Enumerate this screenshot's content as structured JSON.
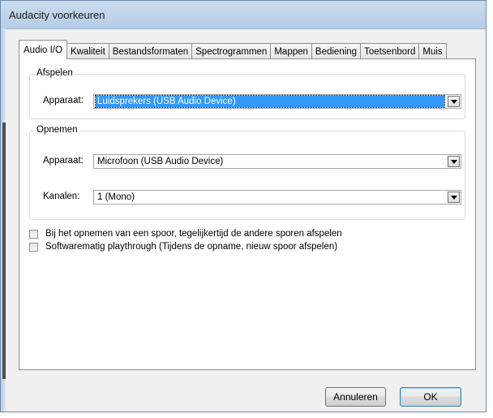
{
  "window": {
    "title": "Audacity voorkeuren"
  },
  "tabs": [
    {
      "label": "Audio I/O",
      "active": true
    },
    {
      "label": "Kwaliteit"
    },
    {
      "label": "Bestandsformaten"
    },
    {
      "label": "Spectrogrammen"
    },
    {
      "label": "Mappen"
    },
    {
      "label": "Bediening"
    },
    {
      "label": "Toetsenbord"
    },
    {
      "label": "Muis"
    }
  ],
  "playback": {
    "legend": "Afspelen",
    "device_label": "Apparaat:",
    "device_value": "Luidsprekers (USB Audio Device)"
  },
  "recording": {
    "legend": "Opnemen",
    "device_label": "Apparaat:",
    "device_value": "Microfoon (USB Audio Device)",
    "channels_label": "Kanalen:",
    "channels_value": "1 (Mono)"
  },
  "options": [
    {
      "label": "Bij het opnemen van een spoor, tegelijkertijd de andere sporen afspelen",
      "checked": false
    },
    {
      "label": "Softwarematig playthrough (Tijdens de opname, nieuw spoor afspelen)",
      "checked": false
    }
  ],
  "buttons": {
    "cancel": "Annuleren",
    "ok": "OK"
  }
}
